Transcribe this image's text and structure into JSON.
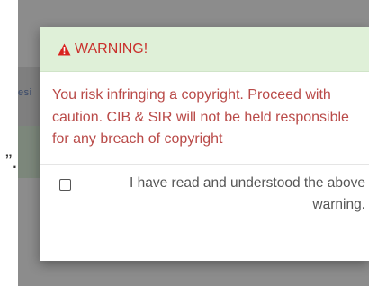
{
  "background": {
    "partial_text": "esi",
    "partial_mark": "”."
  },
  "modal": {
    "header": {
      "icon": "warning-triangle-icon",
      "title": "WARNING!"
    },
    "body": {
      "message": "You risk infringing a copyright. Proceed with caution. CIB & SIR will not be held responsible for any breach of copyright"
    },
    "footer": {
      "checkbox_checked": false,
      "checkbox_label": "I have read and understood the above warning."
    }
  },
  "colors": {
    "header_bg": "#dff0d8",
    "warning_red": "#b94a48",
    "icon_red": "#d9231f"
  }
}
